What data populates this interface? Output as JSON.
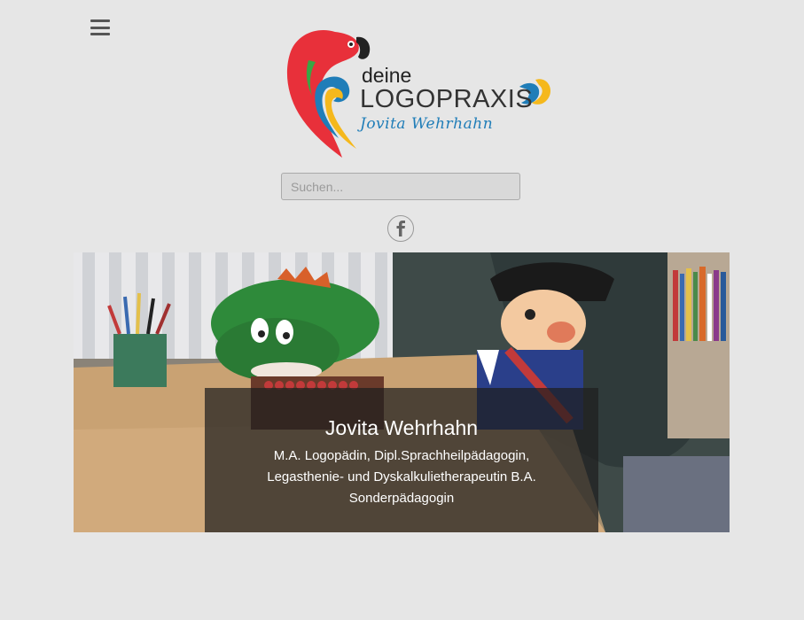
{
  "menu": {
    "icon": "hamburger-menu-icon"
  },
  "logo": {
    "line1": "deine",
    "line2": "LOGOPRAXIS",
    "line3": "Jovita Wehrhahn",
    "colors": {
      "red": "#e8303a",
      "yellow": "#f5b81c",
      "blue": "#1f7db8",
      "green": "#3aa644"
    }
  },
  "search": {
    "placeholder": "Suchen..."
  },
  "social": {
    "facebook_icon": "facebook-icon"
  },
  "hero": {
    "title": "Jovita Wehrhahn",
    "lines": [
      "M.A. Logopädin, Dipl.Sprachheilpädagogin,",
      "Legasthenie- und Dyskalkulietherapeutin B.A.",
      "Sonderpädagogin"
    ]
  }
}
